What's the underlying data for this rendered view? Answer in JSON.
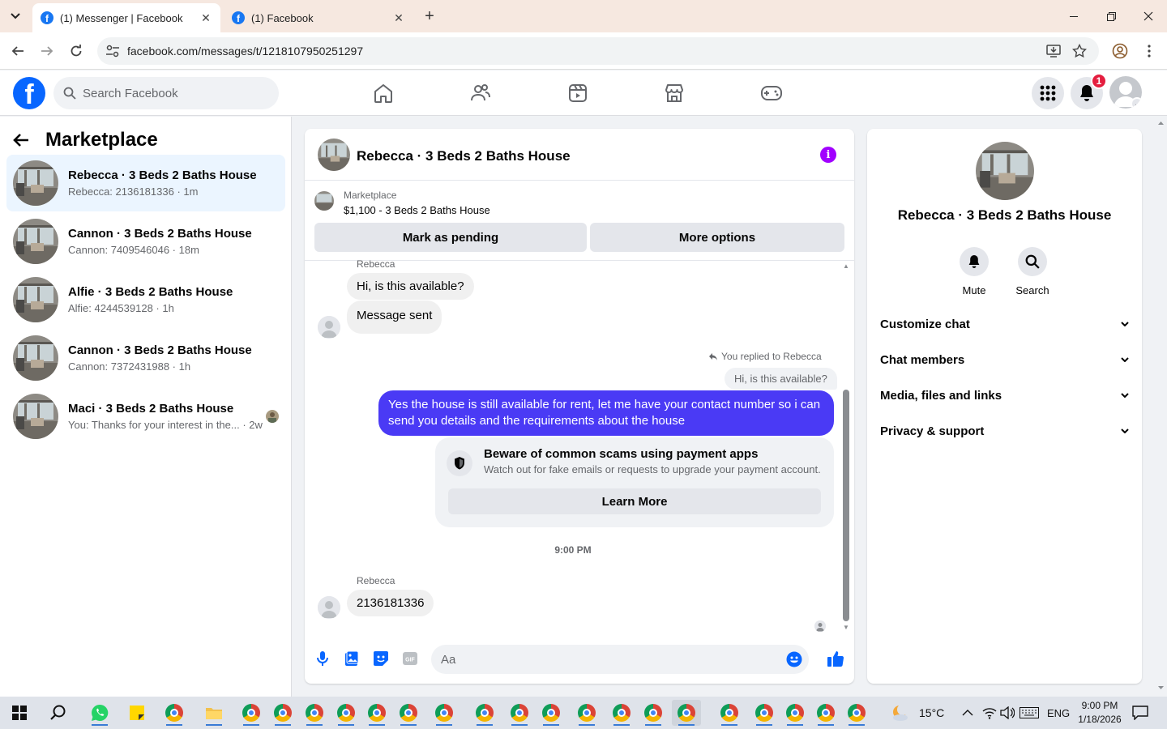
{
  "browser": {
    "tabs": [
      {
        "title": "(1) Messenger | Facebook",
        "active": true
      },
      {
        "title": "(1) Facebook",
        "active": false
      }
    ],
    "url": "facebook.com/messages/t/1218107950251297"
  },
  "fbnav": {
    "search_placeholder": "Search Facebook",
    "notification_count": "1",
    "icons": [
      "home-icon",
      "friends-icon",
      "video-icon",
      "marketplace-icon",
      "gaming-icon"
    ]
  },
  "sidebar": {
    "title": "Marketplace",
    "conversations": [
      {
        "title": "Rebecca · 3 Beds 2 Baths House",
        "preview": "Rebecca: 2136181336",
        "time": "1m",
        "active": true
      },
      {
        "title": "Cannon · 3 Beds 2 Baths House",
        "preview": "Cannon: 7409546046",
        "time": "18m",
        "active": false
      },
      {
        "title": "Alfie · 3 Beds 2 Baths House",
        "preview": "Alfie: 4244539128",
        "time": "1h",
        "active": false
      },
      {
        "title": "Cannon · 3 Beds 2 Baths House",
        "preview": "Cannon: 7372431988",
        "time": "1h",
        "active": false
      },
      {
        "title": "Maci · 3 Beds 2 Baths House",
        "preview": "You: Thanks for your interest in the...",
        "time": "2w",
        "active": false
      }
    ]
  },
  "chat": {
    "title": "Rebecca · 3 Beds 2 Baths House",
    "listing_label": "Marketplace",
    "listing_title": "$1,100 - 3 Beds 2 Baths House",
    "mark_pending_label": "Mark as pending",
    "more_options_label": "More options",
    "sender_name": "Rebecca",
    "msg_1": "Hi, is this available?",
    "msg_2": "Message sent",
    "reply_note": "You replied to Rebecca",
    "quoted_text": "Hi, is this available?",
    "outgoing_text": "Yes the house is still available for rent, let me have your contact number so i can send you details and the requirements about the house",
    "warning_title": "Beware of common scams using payment apps",
    "warning_text": "Watch out for fake emails or requests to upgrade your payment account.",
    "learn_more_label": "Learn More",
    "timestamp": "9:00 PM",
    "sender_name_2": "Rebecca",
    "msg_3": "2136181336",
    "composer_placeholder": "Aa",
    "colors": {
      "outgoing_bubble": "#4a3af5",
      "info_accent": "#a100ff",
      "brand": "#0866ff"
    }
  },
  "rpanel": {
    "title": "Rebecca · 3 Beds 2 Baths House",
    "mute_label": "Mute",
    "search_label": "Search",
    "sections": [
      "Customize chat",
      "Chat members",
      "Media, files and links",
      "Privacy & support"
    ]
  },
  "taskbar": {
    "weather": "15°C",
    "language": "ENG",
    "time": "9:00 PM",
    "date": "1/18/2026"
  }
}
